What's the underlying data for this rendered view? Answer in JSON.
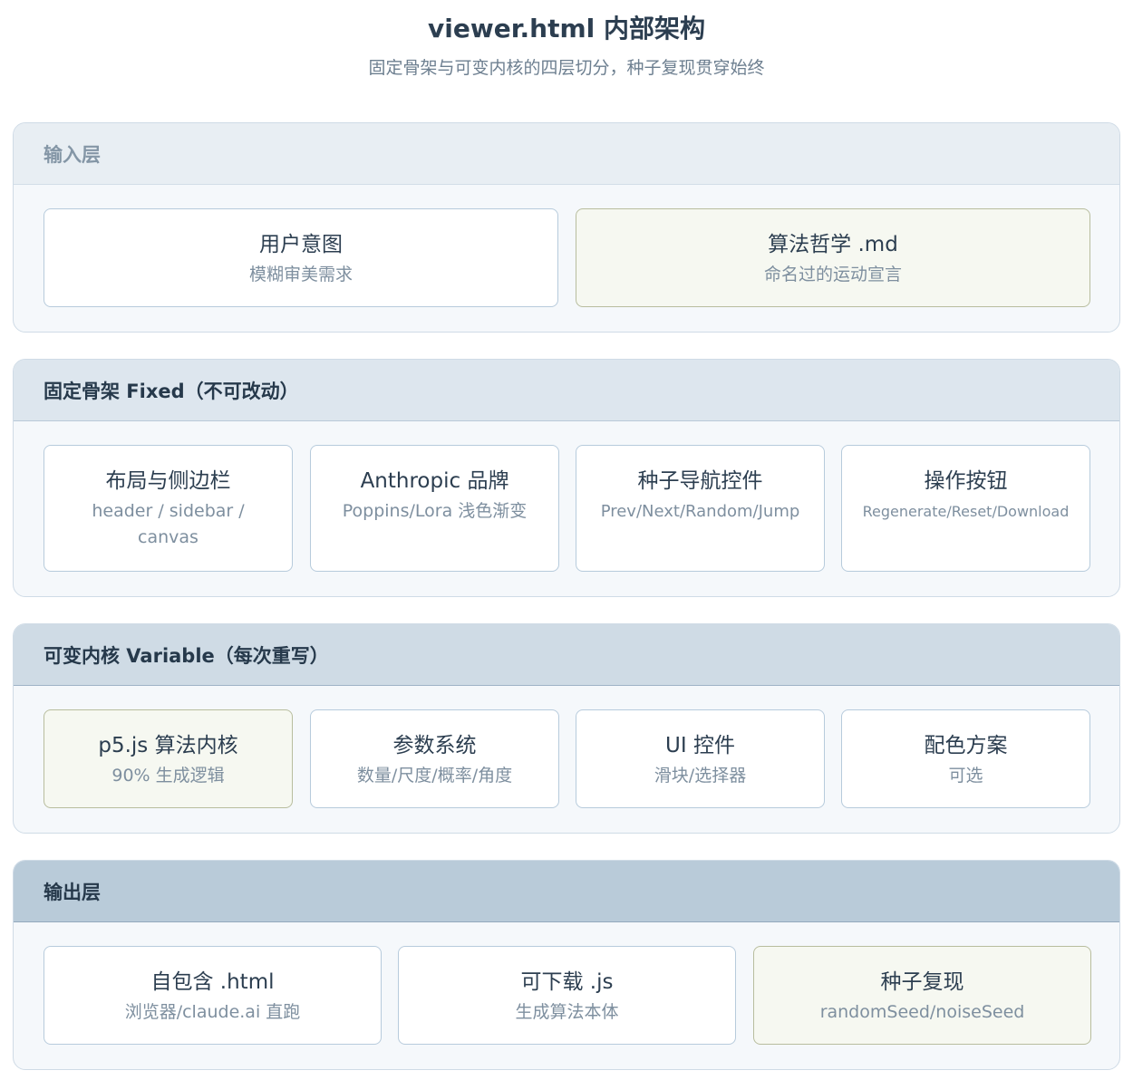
{
  "title": "viewer.html 内部架构",
  "subtitle": "固定骨架与可变内核的四层切分，种子复现贯穿始终",
  "layers": [
    {
      "label": "输入层",
      "items": [
        {
          "main": "用户意图",
          "sub": "模糊审美需求"
        },
        {
          "main": "算法哲学 .md",
          "sub": "命名过的运动宣言"
        }
      ]
    },
    {
      "label": "固定骨架 Fixed（不可改动）",
      "items": [
        {
          "main": "布局与侧边栏",
          "sub": "header / sidebar / canvas"
        },
        {
          "main": "Anthropic 品牌",
          "sub": "Poppins/Lora 浅色渐变"
        },
        {
          "main": "种子导航控件",
          "sub": "Prev/Next/Random/Jump"
        },
        {
          "main": "操作按钮",
          "sub": "Regenerate/Reset/Download"
        }
      ]
    },
    {
      "label": "可变内核 Variable（每次重写）",
      "items": [
        {
          "main": "p5.js 算法内核",
          "sub": "90% 生成逻辑"
        },
        {
          "main": "参数系统",
          "sub": "数量/尺度/概率/角度"
        },
        {
          "main": "UI 控件",
          "sub": "滑块/选择器"
        },
        {
          "main": "配色方案",
          "sub": "可选"
        }
      ]
    },
    {
      "label": "输出层",
      "items": [
        {
          "main": "自包含 .html",
          "sub": "浏览器/claude.ai 直跑"
        },
        {
          "main": "可下载 .js",
          "sub": "生成算法本体"
        },
        {
          "main": "种子复现",
          "sub": "randomSeed/noiseSeed"
        }
      ]
    }
  ]
}
